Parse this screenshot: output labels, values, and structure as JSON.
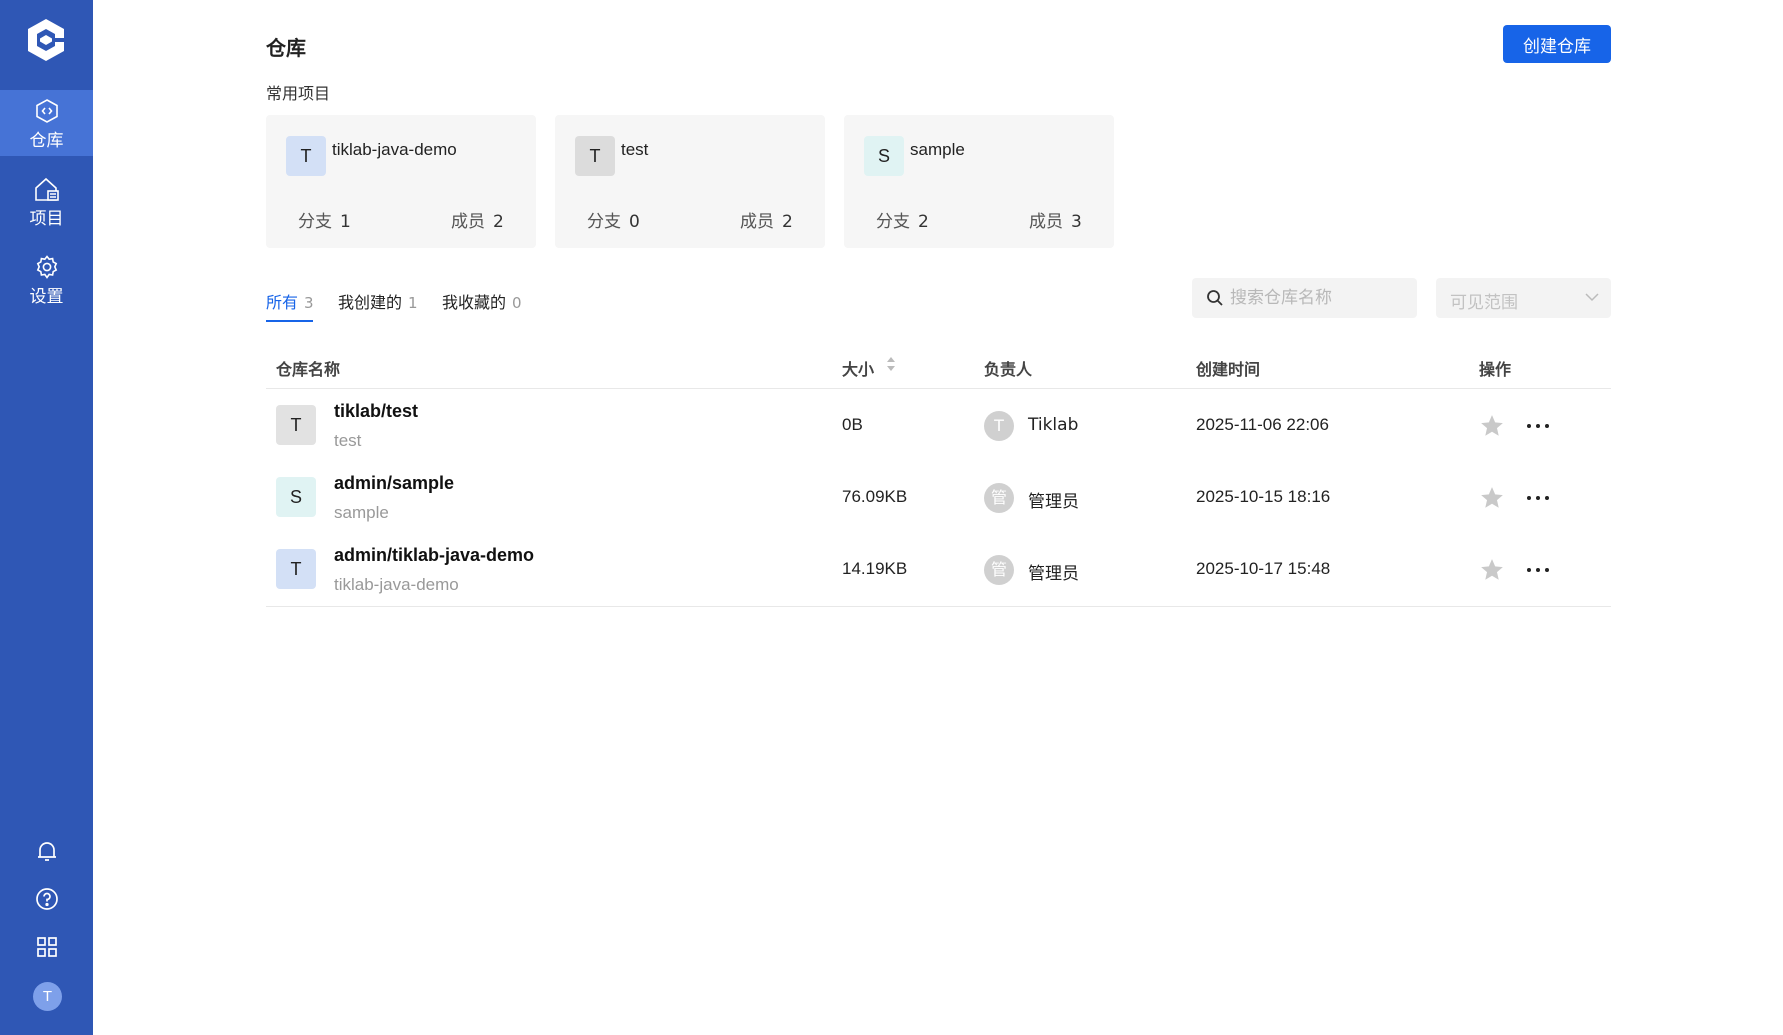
{
  "sidebar": {
    "items": [
      {
        "label": "仓库",
        "icon": "repository-icon",
        "active": true
      },
      {
        "label": "项目",
        "icon": "project-icon",
        "active": false
      },
      {
        "label": "设置",
        "icon": "gear-icon",
        "active": false
      }
    ],
    "bottom_icons": [
      "bell-icon",
      "help-icon",
      "apps-grid-icon"
    ],
    "user_initial": "T",
    "brand_color": "#2f57b5"
  },
  "header": {
    "title": "仓库",
    "create_button": "创建仓库"
  },
  "recent": {
    "title": "常用项目",
    "branch_label": "分支",
    "member_label": "成员",
    "cards": [
      {
        "initial": "T",
        "name": "tiklab-java-demo",
        "branches": "1",
        "members": "2",
        "color": "#d3e0f6"
      },
      {
        "initial": "T",
        "name": "test",
        "branches": "0",
        "members": "2",
        "color": "#dcdcdc"
      },
      {
        "initial": "S",
        "name": "sample",
        "branches": "2",
        "members": "3",
        "color": "#e0f3f3"
      }
    ]
  },
  "tabs": [
    {
      "label": "所有",
      "count": "3",
      "active": true
    },
    {
      "label": "我创建的",
      "count": "1",
      "active": false
    },
    {
      "label": "我收藏的",
      "count": "0",
      "active": false
    }
  ],
  "search": {
    "placeholder": "搜索仓库名称"
  },
  "filter": {
    "placeholder": "可见范围"
  },
  "table": {
    "columns": [
      "仓库名称",
      "大小",
      "负责人",
      "创建时间",
      "操作"
    ],
    "rows": [
      {
        "initial": "T",
        "color": "#e2e2e2",
        "path": "tiklab/test",
        "desc": "test",
        "size": "0B",
        "owner_initial": "T",
        "owner": "Tiklab",
        "created": "2025-11-06 22:06"
      },
      {
        "initial": "S",
        "color": "#e0f3f3",
        "path": "admin/sample",
        "desc": "sample",
        "size": "76.09KB",
        "owner_initial": "管",
        "owner": "管理员",
        "created": "2025-10-15 18:16"
      },
      {
        "initial": "T",
        "color": "#d3e0f6",
        "path": "admin/tiklab-java-demo",
        "desc": "tiklab-java-demo",
        "size": "14.19KB",
        "owner_initial": "管",
        "owner": "管理员",
        "created": "2025-10-17 15:48"
      }
    ]
  },
  "accent_color": "#1764e8"
}
